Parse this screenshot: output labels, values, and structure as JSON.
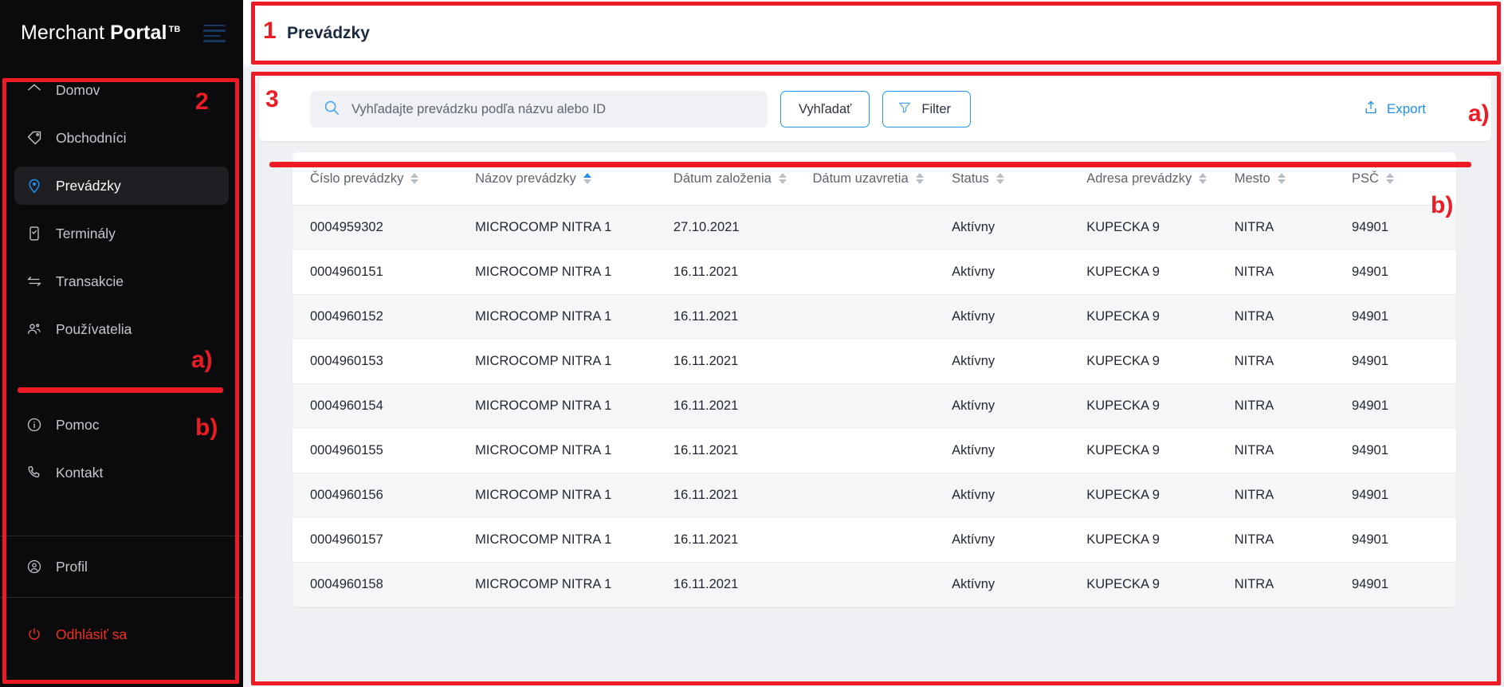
{
  "brand": {
    "name_light": "Merchant ",
    "name_bold": "Portal",
    "trademark": "TB",
    "menu_icon": "hamburger-icon"
  },
  "sidebar": {
    "primary_items": [
      {
        "label": "Domov",
        "icon": "home-icon",
        "active": false
      },
      {
        "label": "Obchodníci",
        "icon": "tag-icon",
        "active": false
      },
      {
        "label": "Prevádzky",
        "icon": "location-pin-icon",
        "active": true
      },
      {
        "label": "Terminály",
        "icon": "terminal-device-icon",
        "active": false
      },
      {
        "label": "Transakcie",
        "icon": "transfer-arrows-icon",
        "active": false
      },
      {
        "label": "Používatelia",
        "icon": "users-icon",
        "active": false
      }
    ],
    "support_items": [
      {
        "label": "Pomoc",
        "icon": "info-circle-icon"
      },
      {
        "label": "Kontakt",
        "icon": "phone-icon"
      }
    ],
    "profile_item": {
      "label": "Profil",
      "icon": "user-circle-icon"
    },
    "logout_item": {
      "label": "Odhlásiť sa",
      "icon": "power-icon"
    }
  },
  "header": {
    "title": "Prevádzky"
  },
  "toolbar": {
    "search_placeholder": "Vyhľadajte prevádzku podľa názvu alebo ID",
    "search_value": "",
    "search_icon": "search-icon",
    "search_button": "Vyhľadať",
    "filter_button": "Filter",
    "filter_icon": "funnel-icon",
    "export_label": "Export",
    "export_icon": "upload-share-icon"
  },
  "table": {
    "columns": [
      {
        "label": "Číslo prevádzky",
        "sorted": false
      },
      {
        "label": "Názov prevádzky",
        "sorted": true,
        "direction": "asc"
      },
      {
        "label": "Dátum založenia",
        "sorted": false
      },
      {
        "label": "Dátum uzavretia",
        "sorted": false
      },
      {
        "label": "Status",
        "sorted": false
      },
      {
        "label": "Adresa prevádzky",
        "sorted": false
      },
      {
        "label": "Mesto",
        "sorted": false
      },
      {
        "label": "PSČ",
        "sorted": false
      }
    ],
    "rows": [
      {
        "cislo": "0004959302",
        "nazov": "MICROCOMP NITRA 1",
        "zalozenie": "27.10.2021",
        "uzavretie": "",
        "status": "Aktívny",
        "adresa": "KUPECKA 9",
        "mesto": "NITRA",
        "psc": "94901"
      },
      {
        "cislo": "0004960151",
        "nazov": "MICROCOMP NITRA 1",
        "zalozenie": "16.11.2021",
        "uzavretie": "",
        "status": "Aktívny",
        "adresa": "KUPECKA 9",
        "mesto": "NITRA",
        "psc": "94901"
      },
      {
        "cislo": "0004960152",
        "nazov": "MICROCOMP NITRA 1",
        "zalozenie": "16.11.2021",
        "uzavretie": "",
        "status": "Aktívny",
        "adresa": "KUPECKA 9",
        "mesto": "NITRA",
        "psc": "94901"
      },
      {
        "cislo": "0004960153",
        "nazov": "MICROCOMP NITRA 1",
        "zalozenie": "16.11.2021",
        "uzavretie": "",
        "status": "Aktívny",
        "adresa": "KUPECKA 9",
        "mesto": "NITRA",
        "psc": "94901"
      },
      {
        "cislo": "0004960154",
        "nazov": "MICROCOMP NITRA 1",
        "zalozenie": "16.11.2021",
        "uzavretie": "",
        "status": "Aktívny",
        "adresa": "KUPECKA 9",
        "mesto": "NITRA",
        "psc": "94901"
      },
      {
        "cislo": "0004960155",
        "nazov": "MICROCOMP NITRA 1",
        "zalozenie": "16.11.2021",
        "uzavretie": "",
        "status": "Aktívny",
        "adresa": "KUPECKA 9",
        "mesto": "NITRA",
        "psc": "94901"
      },
      {
        "cislo": "0004960156",
        "nazov": "MICROCOMP NITRA 1",
        "zalozenie": "16.11.2021",
        "uzavretie": "",
        "status": "Aktívny",
        "adresa": "KUPECKA 9",
        "mesto": "NITRA",
        "psc": "94901"
      },
      {
        "cislo": "0004960157",
        "nazov": "MICROCOMP NITRA 1",
        "zalozenie": "16.11.2021",
        "uzavretie": "",
        "status": "Aktívny",
        "adresa": "KUPECKA 9",
        "mesto": "NITRA",
        "psc": "94901"
      },
      {
        "cislo": "0004960158",
        "nazov": "MICROCOMP NITRA 1",
        "zalozenie": "16.11.2021",
        "uzavretie": "",
        "status": "Aktívny",
        "adresa": "KUPECKA 9",
        "mesto": "NITRA",
        "psc": "94901"
      }
    ]
  },
  "annotations": {
    "marker_1": "1",
    "marker_2": "2",
    "marker_3": "3",
    "marker_sidebar_a": "a)",
    "marker_sidebar_b": "b)",
    "marker_toolbar_a": "a)",
    "marker_table_b": "b)"
  },
  "colors": {
    "annotation_red": "#ed1c24",
    "brand_red": "#ef3124",
    "accent_blue": "#1e90f5",
    "sidebar_bg": "#0b0b0d",
    "title_navy": "#1b2a41"
  }
}
